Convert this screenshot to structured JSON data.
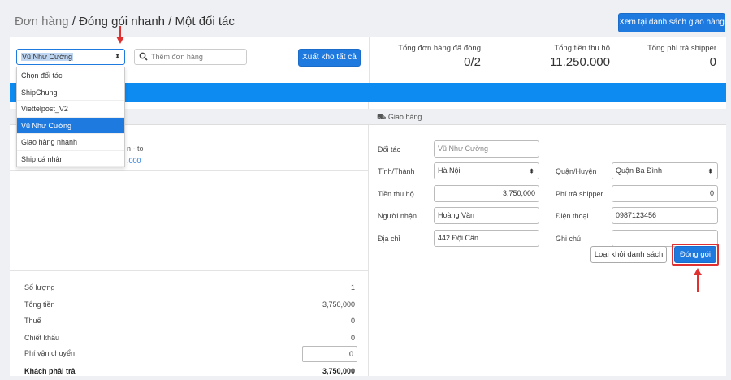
{
  "breadcrumb": {
    "root": "Đơn hàng",
    "sep": " / ",
    "mid": "Đóng gói nhanh",
    "current": "Một đối tác"
  },
  "header": {
    "view_list_label": "Xem tại danh sách giao hàng"
  },
  "toolbar": {
    "partner_selected": "Vũ Như Cường",
    "search_placeholder": "Thêm đơn hàng",
    "export_all_label": "Xuất kho tất cả"
  },
  "stats": [
    {
      "label": "Tổng đơn hàng đã đóng",
      "value": "0/2"
    },
    {
      "label": "Tổng tiền thu hộ",
      "value": "11.250.000"
    },
    {
      "label": "Tổng phí trả shipper",
      "value": "0"
    }
  ],
  "partner_dropdown": {
    "options": [
      "Chọn đối tác",
      "ShipChung",
      "Viettelpost_V2",
      "Vũ Như Cường",
      "Giao hàng nhanh",
      "Ship cá nhân"
    ],
    "active_index": 3
  },
  "order_line": {
    "name_partial": "n - to",
    "price_partial": ",000"
  },
  "summary": {
    "quantity_label": "Số lượng",
    "quantity_value": "1",
    "total_label": "Tổng tiền",
    "total_value": "3,750,000",
    "tax_label": "Thuế",
    "tax_value": "0",
    "discount_label": "Chiết khấu",
    "discount_value": "0",
    "shipping_label": "Phí vận chuyển",
    "shipping_value": "0",
    "customer_pays_label": "Khách phải trả",
    "customer_pays_value": "3,750,000"
  },
  "delivery": {
    "section_title": "Giao hàng",
    "partner_label": "Đối tác",
    "partner_value": "Vũ Như Cường",
    "province_label": "Tỉnh/Thành",
    "province_value": "Hà Nội",
    "district_label": "Quận/Huyện",
    "district_value": "Quận Ba Đình",
    "cod_label": "Tiền thu hộ",
    "cod_value": "3,750,000",
    "shipper_fee_label": "Phí trả shipper",
    "shipper_fee_value": "0",
    "receiver_label": "Người nhận",
    "receiver_value": "Hoàng Văn",
    "phone_label": "Điện thoại",
    "phone_value": "0987123456",
    "address_label": "Địa chỉ",
    "address_value": "442 Đội Cấn",
    "note_label": "Ghi chú",
    "note_value": "",
    "remove_label": "Loại khỏi danh sách",
    "pack_label": "Đóng gói"
  },
  "colors": {
    "accent": "#1f7ae0",
    "bar": "#0d8bf0",
    "annotation": "#e03030"
  }
}
